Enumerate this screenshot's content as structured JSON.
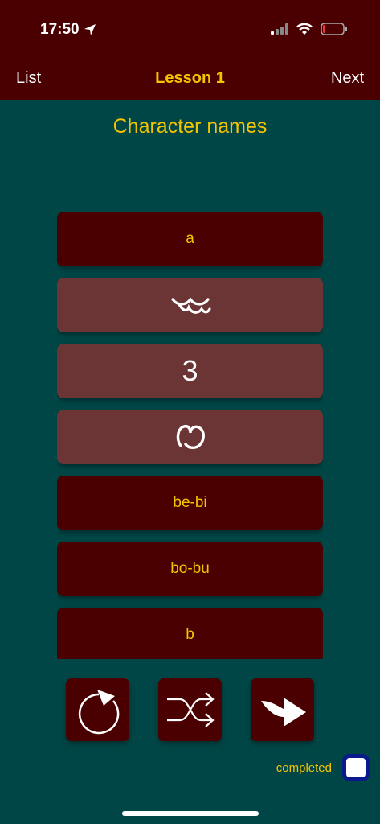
{
  "status": {
    "time": "17:50"
  },
  "nav": {
    "left": "List",
    "title": "Lesson 1",
    "right": "Next"
  },
  "heading": "Character names",
  "cards": [
    {
      "label": "a",
      "style": "dark"
    },
    {
      "label": "",
      "style": "light",
      "glyph": "character-glyph-1"
    },
    {
      "label": "3",
      "style": "light"
    },
    {
      "label": "",
      "style": "light",
      "glyph": "character-glyph-3"
    },
    {
      "label": "be-bi",
      "style": "dark"
    },
    {
      "label": "bo-bu",
      "style": "dark"
    },
    {
      "label": "b",
      "style": "dark"
    }
  ],
  "controls": {
    "icons": [
      "restart-icon",
      "shuffle-icon",
      "forward-arrow-icon"
    ]
  },
  "completed": {
    "label": "completed",
    "checked": false
  },
  "colors": {
    "accent": "#f5c400",
    "bar": "#4a0000",
    "background": "#014646",
    "card_light": "#6b3535",
    "checkbox_border": "#0a1a8c"
  }
}
